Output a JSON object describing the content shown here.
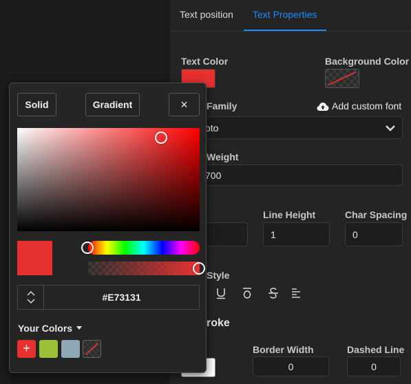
{
  "tabs": [
    {
      "label": "Text position",
      "active": false
    },
    {
      "label": "Text Properties",
      "active": true
    }
  ],
  "accent_color": "#1e88ff",
  "text_color": {
    "label": "Text Color",
    "value": "#E73131"
  },
  "background_color": {
    "label": "Background Color",
    "value": "none"
  },
  "font_family": {
    "label_partial": "Family",
    "value_partial": "oto",
    "add_custom_label": "Add custom font",
    "add_icon": "cloud-upload-icon",
    "dropdown_icon": "chevron-down-icon"
  },
  "font_weight": {
    "label_partial": "Weight",
    "value_partial": "700"
  },
  "line_height": {
    "label": "Line Height",
    "value": "1"
  },
  "char_spacing": {
    "label": "Char Spacing",
    "value": "0"
  },
  "text_style": {
    "label_partial": "Style",
    "icons": [
      "underline-icon",
      "overline-icon",
      "strikethrough-icon",
      "align-left-icon"
    ]
  },
  "stroke": {
    "label_partial": "roke"
  },
  "border_width": {
    "label": "Border Width",
    "value": "0"
  },
  "dashed_line": {
    "label": "Dashed Line",
    "value": "0"
  },
  "picker": {
    "solid_label": "Solid",
    "gradient_label": "Gradient",
    "close_label": "×",
    "hue": 0,
    "saturation": 0.79,
    "brightness": 0.91,
    "alpha": 1,
    "hex": "#E73131",
    "your_colors_label": "Your Colors",
    "add_label": "+",
    "swatches": [
      "#9ac137",
      "#8ea9b5"
    ]
  }
}
